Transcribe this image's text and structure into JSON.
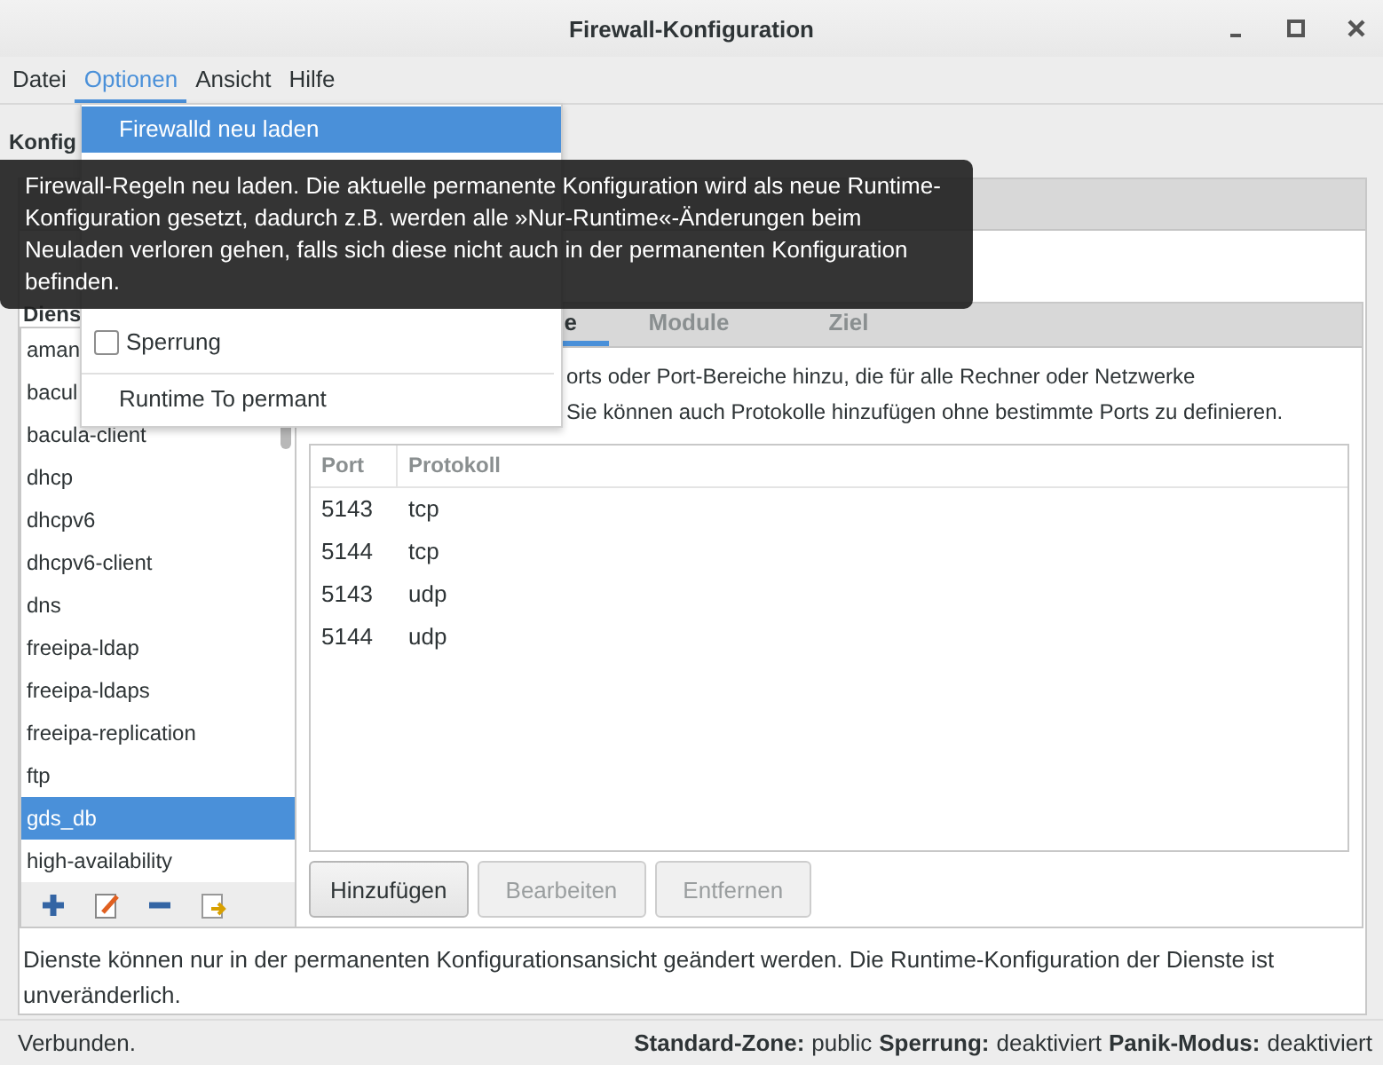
{
  "window": {
    "title": "Firewall-Konfiguration"
  },
  "menubar": [
    {
      "label": "Datei",
      "selected": false
    },
    {
      "label": "Optionen",
      "selected": true
    },
    {
      "label": "Ansicht",
      "selected": false
    },
    {
      "label": "Hilfe",
      "selected": false
    }
  ],
  "open_menu": [
    {
      "kind": "item",
      "label": "Firewalld neu laden",
      "selected": true
    },
    {
      "kind": "check",
      "label": "Sperrung",
      "checked": false
    },
    {
      "kind": "separator"
    },
    {
      "kind": "item",
      "label": "Runtime To permant",
      "selected": false
    }
  ],
  "tooltip": "Firewall-Regeln neu laden. Die aktuelle permanente Konfiguration wird als neue Runtime-Konfiguration gesetzt, dadurch z.B. werden alle »Nur-Runtime«-Änderungen beim Neuladen verloren gehen, falls sich diese nicht auch in der permanenten Konfiguration befinden.",
  "configuration_label": "Konfig",
  "services_label": "Diens",
  "services": [
    {
      "name": "aman",
      "selected": false
    },
    {
      "name": "bacul",
      "selected": false
    },
    {
      "name": "bacula-client",
      "selected": false
    },
    {
      "name": "dhcp",
      "selected": false
    },
    {
      "name": "dhcpv6",
      "selected": false
    },
    {
      "name": "dhcpv6-client",
      "selected": false
    },
    {
      "name": "dns",
      "selected": false
    },
    {
      "name": "freeipa-ldap",
      "selected": false
    },
    {
      "name": "freeipa-ldaps",
      "selected": false
    },
    {
      "name": "freeipa-replication",
      "selected": false
    },
    {
      "name": "ftp",
      "selected": false
    },
    {
      "name": "gds_db",
      "selected": true
    },
    {
      "name": "high-availability",
      "selected": false
    }
  ],
  "service_tabs": [
    {
      "label": "e",
      "selected": true
    },
    {
      "label": "Module",
      "selected": false
    },
    {
      "label": "Ziel",
      "selected": false
    }
  ],
  "ports_description": [
    "orts oder Port-Bereiche hinzu, die für alle Rechner oder Netzwerke",
    "Sie können auch Protokolle hinzufügen ohne bestimmte Ports zu definieren."
  ],
  "ports_table": {
    "columns": [
      "Port",
      "Protokoll"
    ],
    "rows": [
      [
        "5143",
        "tcp"
      ],
      [
        "5144",
        "tcp"
      ],
      [
        "5143",
        "udp"
      ],
      [
        "5144",
        "udp"
      ]
    ]
  },
  "buttons": [
    {
      "label": "Hinzufügen",
      "disabled": false
    },
    {
      "label": "Bearbeiten",
      "disabled": true
    },
    {
      "label": "Entfernen",
      "disabled": true
    }
  ],
  "note": "Dienste können nur in der permanenten Konfigurationsansicht geändert werden. Die Runtime-Konfiguration der Dienste ist unveränderlich.",
  "status_bar": {
    "connection": "Verbunden.",
    "fields": [
      {
        "label": "Standard-Zone:",
        "value": "public"
      },
      {
        "label": "Sperrung:",
        "value": "deaktiviert"
      },
      {
        "label": "Panik-Modus:",
        "value": "deaktiviert"
      }
    ]
  }
}
